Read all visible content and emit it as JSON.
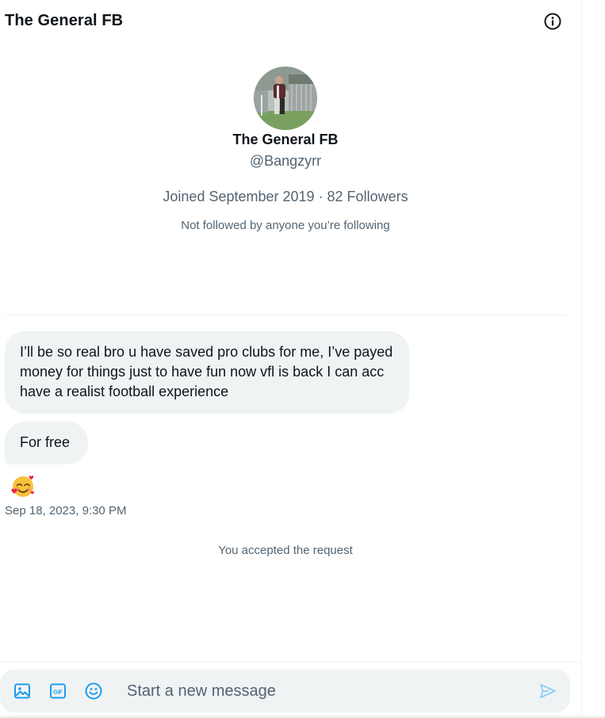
{
  "header": {
    "title": "The General FB",
    "info_icon": "info-icon"
  },
  "profile": {
    "name": "The General FB",
    "handle": "@Bangzyrr",
    "meta": "Joined September 2019 · 82 Followers",
    "note": "Not followed by anyone you’re following",
    "avatar_icon": "profile-photo"
  },
  "messages": [
    {
      "text": "I’ll be so real bro u have saved pro clubs for me, I’ve payed money for things just to have fun now vfl is back I can acc have a realist football experience"
    },
    {
      "text": "For free"
    },
    {
      "emoji": "smiling-face-with-hearts"
    }
  ],
  "timestamp": "Sep 18, 2023, 9:30 PM",
  "system_note": "You accepted the request",
  "composer": {
    "placeholder": "Start a new message",
    "value": "",
    "icons": [
      "image-icon",
      "gif-icon",
      "emoji-icon",
      "send-icon"
    ]
  },
  "colors": {
    "accent": "#1d9bf0",
    "bubble": "#eff3f4",
    "secondary_text": "#536471",
    "primary_text": "#0f1419"
  }
}
